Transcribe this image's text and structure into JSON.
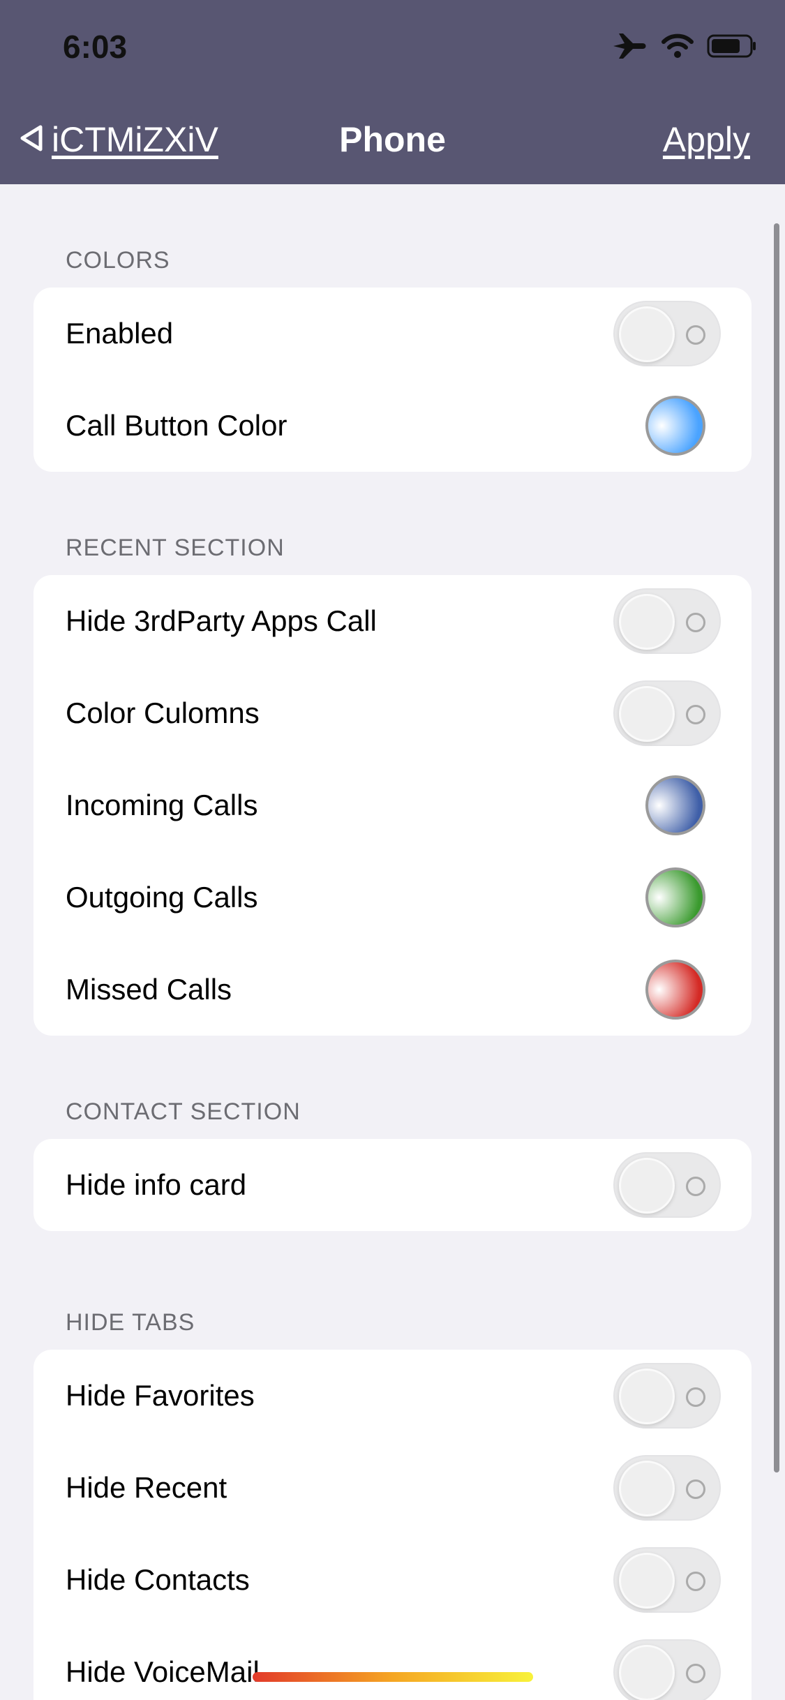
{
  "status_bar": {
    "time": "6:03",
    "icons": [
      "airplane-icon",
      "wifi-icon",
      "battery-icon"
    ]
  },
  "nav": {
    "back_label": "iCTMiZXiV",
    "title": "Phone",
    "apply_label": "Apply"
  },
  "sections": {
    "colors": {
      "header": "COLORS",
      "enabled": {
        "label": "Enabled",
        "on": false
      },
      "call_button_color": {
        "label": "Call Button Color",
        "color": "#4aa3ff"
      }
    },
    "recent": {
      "header": "RECENT SECTION",
      "hide_3rd_party": {
        "label": "Hide 3rdParty Apps Call",
        "on": false
      },
      "color_columns": {
        "label": "Color Culomns",
        "on": false
      },
      "incoming": {
        "label": "Incoming Calls",
        "color": "#3f5fa8"
      },
      "outgoing": {
        "label": "Outgoing Calls",
        "color": "#3a9a2e"
      },
      "missed": {
        "label": "Missed Calls",
        "color": "#d42a25"
      }
    },
    "contact": {
      "header": "CONTACT SECTION",
      "hide_info_card": {
        "label": "Hide info card",
        "on": false
      }
    },
    "hide_tabs": {
      "header": "HIDE TABS",
      "hide_favorites": {
        "label": "Hide Favorites",
        "on": false
      },
      "hide_recent": {
        "label": "Hide Recent",
        "on": false
      },
      "hide_contacts": {
        "label": "Hide Contacts",
        "on": false
      },
      "hide_voicemail": {
        "label": "Hide VoiceMail",
        "on": false
      }
    }
  },
  "colors": {
    "header_bg": "#585672",
    "page_bg": "#f2f1f6"
  }
}
